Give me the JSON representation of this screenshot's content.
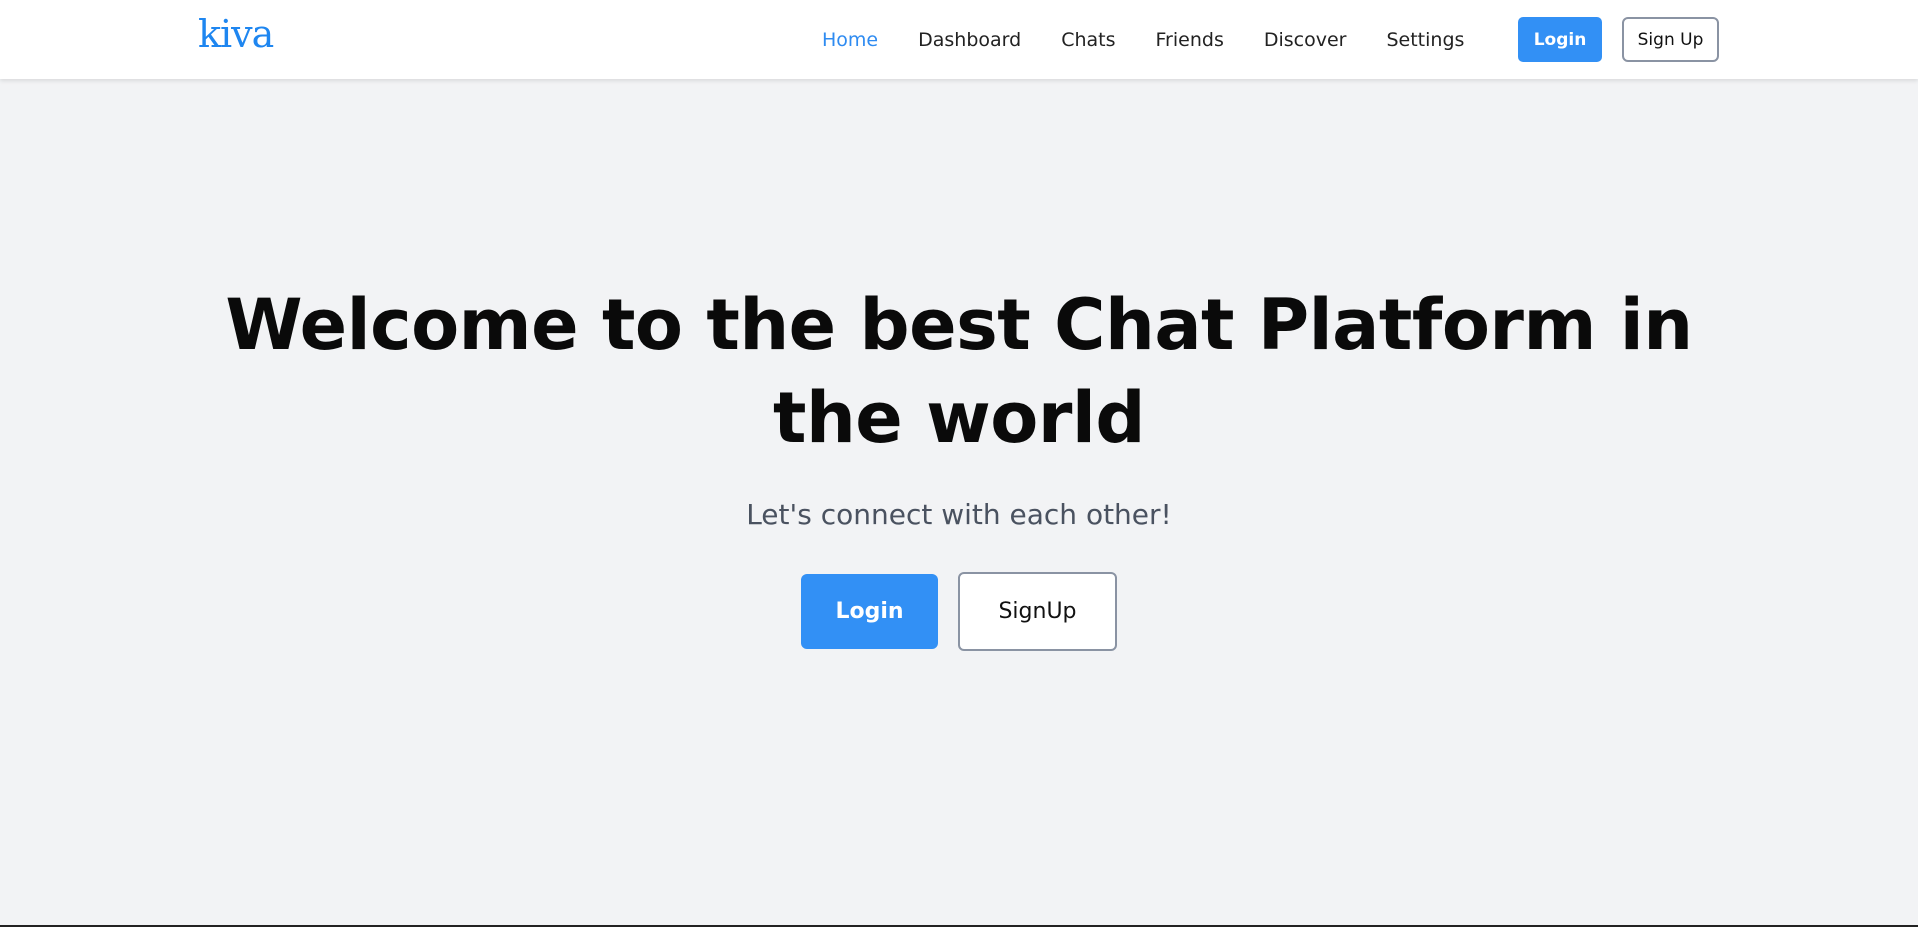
{
  "brand": {
    "logo_text": "kiva",
    "color": "#1e86f0"
  },
  "nav": {
    "links": [
      {
        "label": "Home",
        "active": true
      },
      {
        "label": "Dashboard",
        "active": false
      },
      {
        "label": "Chats",
        "active": false
      },
      {
        "label": "Friends",
        "active": false
      },
      {
        "label": "Discover",
        "active": false
      },
      {
        "label": "Settings",
        "active": false
      }
    ],
    "login_label": "Login",
    "signup_label": "Sign Up"
  },
  "hero": {
    "title": "Welcome to the best Chat Platform in the world",
    "subtitle": "Let's connect with each other!",
    "login_label": "Login",
    "signup_label": "SignUp"
  },
  "colors": {
    "accent": "#3290f5",
    "active_link": "#2e8bf1",
    "background": "#f2f3f5",
    "button_border": "#8a93a3"
  }
}
